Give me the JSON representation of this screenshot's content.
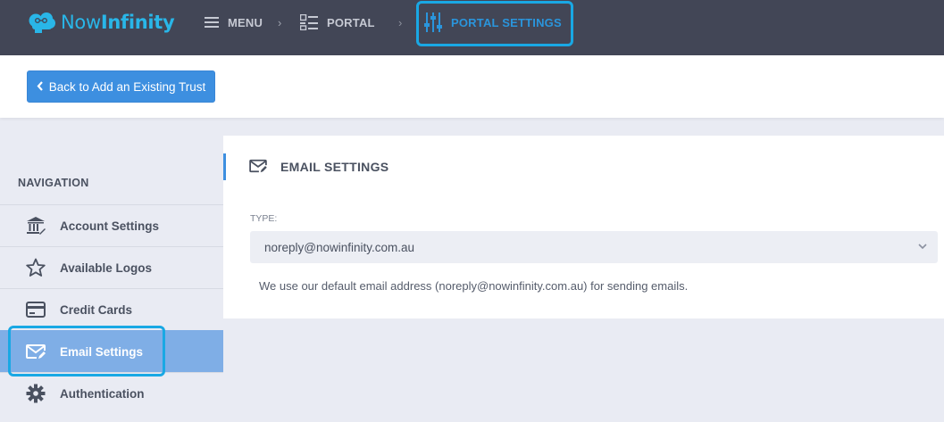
{
  "app": {
    "logo_text_light": "Now",
    "logo_text_bold": "Infinity",
    "brand_color": "#29b6e8"
  },
  "breadcrumb": {
    "items": [
      {
        "label": "MENU",
        "icon": "hamburger-icon"
      },
      {
        "label": "PORTAL",
        "icon": "list-icon"
      },
      {
        "label": "PORTAL SETTINGS",
        "icon": "sliders-icon"
      }
    ],
    "separator": "›"
  },
  "subheader": {
    "back_button_label": "Back to Add an Existing Trust",
    "back_button_icon": "chevron-left-icon"
  },
  "sidebar": {
    "title": "NAVIGATION",
    "items": [
      {
        "label": "Account Settings",
        "icon": "bank-icon",
        "active": false
      },
      {
        "label": "Available Logos",
        "icon": "star-icon",
        "active": false
      },
      {
        "label": "Credit Cards",
        "icon": "credit-card-icon",
        "active": false
      },
      {
        "label": "Email Settings",
        "icon": "email-icon",
        "active": true
      },
      {
        "label": "Authentication",
        "icon": "gear-icon",
        "active": false
      }
    ]
  },
  "main": {
    "title": "EMAIL SETTINGS",
    "title_icon": "email-icon",
    "type_label": "TYPE:",
    "type_value": "noreply@nowinfinity.com.au",
    "help_text": "We use our default email address (noreply@nowinfinity.com.au) for sending emails."
  },
  "colors": {
    "topbar": "#424656",
    "accent": "#3d8fe0",
    "highlight": "#19a8e4",
    "active_nav": "#7faee6"
  }
}
